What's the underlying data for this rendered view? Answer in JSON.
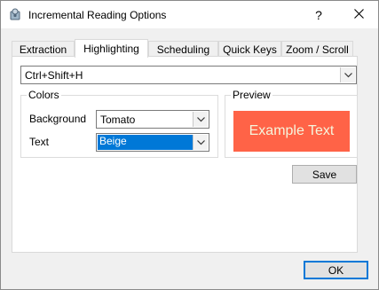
{
  "window": {
    "title": "Incremental Reading Options"
  },
  "titlebar": {
    "help_label": "?"
  },
  "tabs": [
    {
      "label": "Extraction"
    },
    {
      "label": "Highlighting"
    },
    {
      "label": "Scheduling"
    },
    {
      "label": "Quick Keys"
    },
    {
      "label": "Zoom / Scroll"
    }
  ],
  "active_tab": "Highlighting",
  "shortcut": {
    "value": "Ctrl+Shift+H"
  },
  "colors": {
    "label": "Colors",
    "background_label": "Background",
    "background_value": "Tomato",
    "text_label": "Text",
    "text_value": "Beige"
  },
  "preview": {
    "label": "Preview",
    "sample_text": "Example Text",
    "background_color": "#ff6347",
    "text_color": "#f5f5dc"
  },
  "buttons": {
    "save": "Save",
    "ok": "OK"
  },
  "icons": {
    "app": "app-icon",
    "close": "close-icon",
    "dropdown": "chevron-down-icon"
  }
}
